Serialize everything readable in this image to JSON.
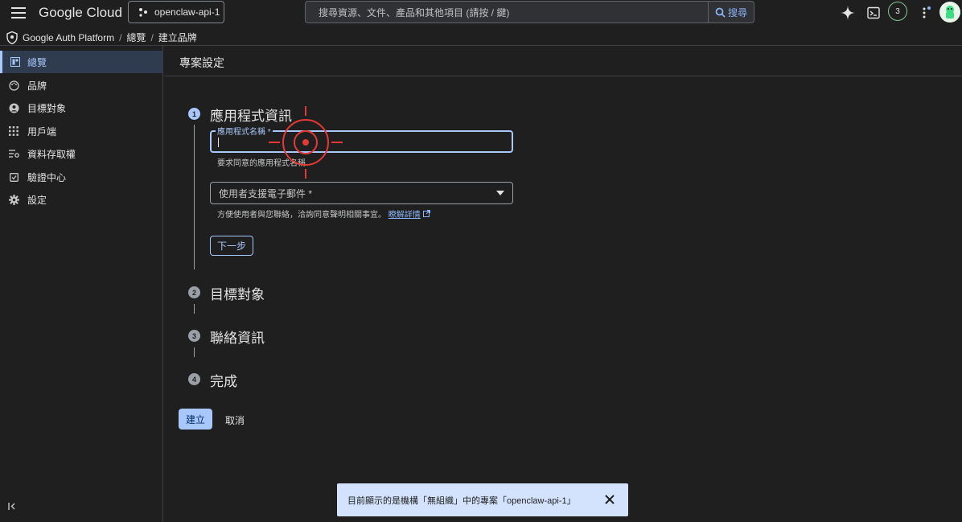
{
  "header": {
    "logo_text": "Google Cloud",
    "project_name": "openclaw-api-1",
    "search_placeholder": "搜尋資源、文件、產品和其他項目 (請按 / 鍵)",
    "search_button": "搜尋",
    "notifications_count": "3"
  },
  "breadcrumb": {
    "root": "Google Auth Platform",
    "items": [
      "總覽",
      "建立品牌"
    ]
  },
  "sidebar": {
    "items": [
      {
        "label": "總覽",
        "icon": "dashboard-icon",
        "active": true
      },
      {
        "label": "品牌",
        "icon": "palette-icon"
      },
      {
        "label": "目標對象",
        "icon": "account-circle-icon"
      },
      {
        "label": "用戶端",
        "icon": "apps-grid-icon"
      },
      {
        "label": "資料存取權",
        "icon": "data-access-icon"
      },
      {
        "label": "驗證中心",
        "icon": "verification-icon"
      },
      {
        "label": "設定",
        "icon": "gear-icon"
      }
    ]
  },
  "page": {
    "title": "專案設定"
  },
  "steps": [
    {
      "number": "1",
      "title": "應用程式資訊"
    },
    {
      "number": "2",
      "title": "目標對象"
    },
    {
      "number": "3",
      "title": "聯絡資訊"
    },
    {
      "number": "4",
      "title": "完成"
    }
  ],
  "form": {
    "app_name_label": "應用程式名稱 *",
    "app_name_value": "",
    "app_name_helper": "要求同意的應用程式名稱",
    "support_email_label": "使用者支援電子郵件 *",
    "support_email_helper": "方便使用者與您聯絡，洽詢同意聲明相關事宜。",
    "learn_more": "瞭解詳情",
    "next_button": "下一步"
  },
  "actions": {
    "create": "建立",
    "cancel": "取消"
  },
  "toast": {
    "message": "目前顯示的是機構「無組織」中的專案「openclaw-api-1」"
  },
  "colors": {
    "accent": "#a8c7fa",
    "link": "#8ab4f8",
    "background": "#1f1f1f",
    "toast_bg": "#d3e3fd",
    "target_marker": "#e53935"
  }
}
